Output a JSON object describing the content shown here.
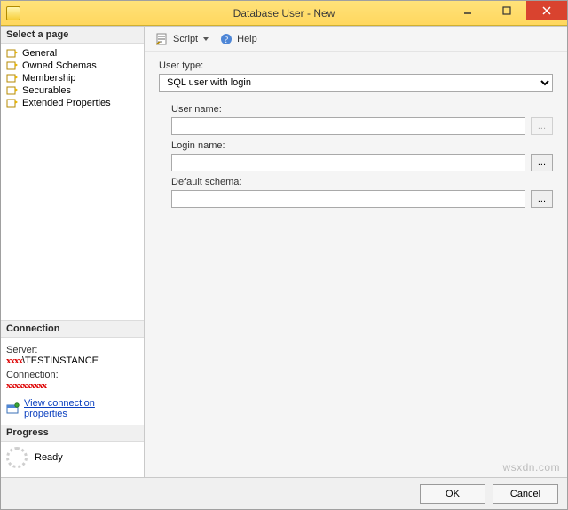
{
  "window": {
    "title": "Database User - New"
  },
  "sidebar": {
    "select_page_header": "Select a page",
    "pages": [
      {
        "label": "General"
      },
      {
        "label": "Owned Schemas"
      },
      {
        "label": "Membership"
      },
      {
        "label": "Securables"
      },
      {
        "label": "Extended Properties"
      }
    ],
    "connection_header": "Connection",
    "server_label": "Server:",
    "server_value_prefix": "xxxx",
    "server_value_suffix": "\\TESTINSTANCE",
    "connection_label": "Connection:",
    "connection_value": "xxxxxxxxxx",
    "view_props_link": "View connection properties",
    "progress_header": "Progress",
    "progress_status": "Ready"
  },
  "toolbar": {
    "script_label": "Script",
    "help_label": "Help"
  },
  "form": {
    "user_type_label": "User type:",
    "user_type_value": "SQL user with login",
    "user_name_label": "User name:",
    "user_name_value": "",
    "login_name_label": "Login name:",
    "login_name_value": "",
    "default_schema_label": "Default schema:",
    "default_schema_value": "",
    "browse_label": "..."
  },
  "footer": {
    "ok_label": "OK",
    "cancel_label": "Cancel"
  },
  "watermark": "wsxdn.com"
}
